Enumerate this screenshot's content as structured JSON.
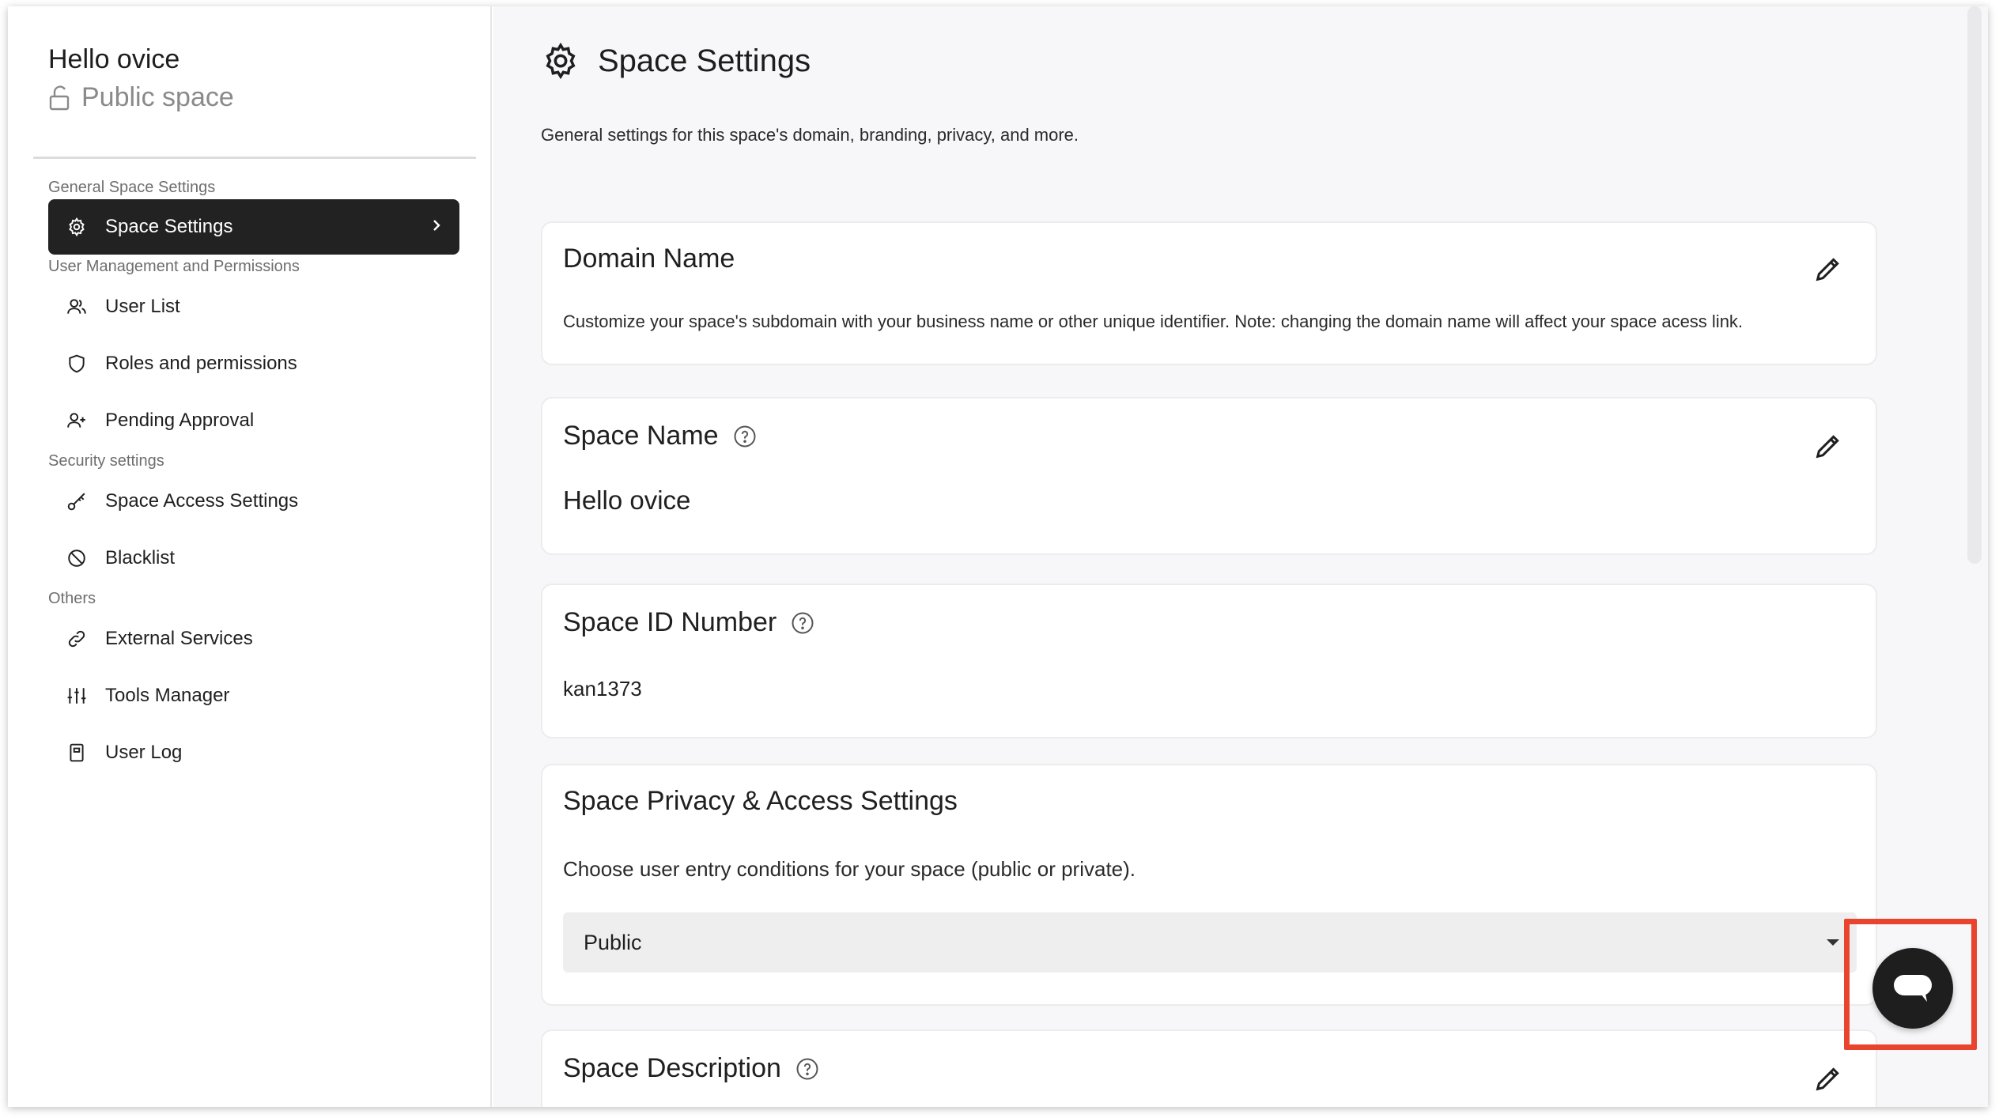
{
  "sidebar": {
    "space_name": "Hello ovice",
    "space_privacy": "Public space",
    "groups": {
      "general": "General Space Settings",
      "users": "User Management and Permissions",
      "security": "Security settings",
      "others": "Others"
    },
    "items": {
      "space_settings": "Space Settings",
      "user_list": "User List",
      "roles": "Roles and permissions",
      "pending": "Pending Approval",
      "access": "Space Access Settings",
      "blacklist": "Blacklist",
      "external": "External Services",
      "tools": "Tools Manager",
      "user_log": "User Log"
    }
  },
  "main": {
    "title": "Space Settings",
    "subtitle": "General settings for this space's domain, branding, privacy, and more.",
    "domain": {
      "title": "Domain Name",
      "description": "Customize your space's subdomain with your business name or other unique identifier. Note: changing the domain name will affect your space acess link."
    },
    "space_name": {
      "title": "Space Name",
      "value": "Hello ovice"
    },
    "space_id": {
      "title": "Space ID Number",
      "value": "kan1373"
    },
    "privacy": {
      "title": "Space Privacy & Access Settings",
      "description": "Choose user entry conditions for your space (public or private).",
      "selected": "Public"
    },
    "description": {
      "title": "Space Description"
    }
  },
  "colors": {
    "active_nav_bg": "#222222",
    "highlight": "#e8442e",
    "chat_fab": "#1e1e1e"
  }
}
